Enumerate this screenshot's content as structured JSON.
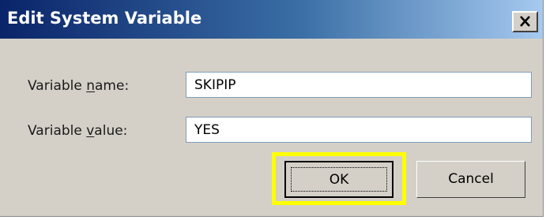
{
  "dialog": {
    "title": "Edit System Variable",
    "close_glyph": "×",
    "close_icon": "close-icon"
  },
  "fields": {
    "name_label_prefix": "Variable ",
    "name_label_mnemonic": "n",
    "name_label_suffix": "ame:",
    "name_value": "SKIPIP",
    "value_label_prefix": "Variable ",
    "value_label_mnemonic": "v",
    "value_label_suffix": "alue:",
    "value_value": "YES"
  },
  "buttons": {
    "ok_label": "OK",
    "cancel_label": "Cancel"
  },
  "colors": {
    "titlebar_start": "#0a246a",
    "titlebar_end": "#a6caf0",
    "highlight": "#ffff00",
    "dialog_face": "#d4d0c8"
  }
}
